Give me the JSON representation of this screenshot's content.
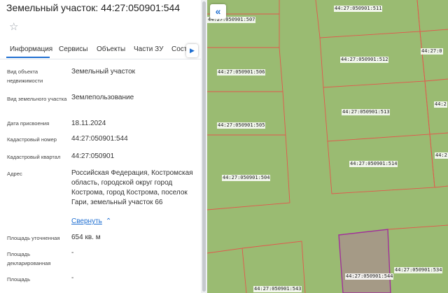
{
  "panel": {
    "title": "Земельный участок: 44:27:050901:544",
    "tabs": [
      "Информация",
      "Сервисы",
      "Объекты",
      "Части ЗУ",
      "Состав"
    ],
    "collapse_link": "Свернуть",
    "fields": [
      {
        "label": "Вид объекта недвижимости",
        "value": "Земельный участок"
      },
      {
        "label": "Вид земельного участка",
        "value": "Землепользование"
      },
      {
        "label": "Дата присвоения",
        "value": "18.11.2024"
      },
      {
        "label": "Кадастровый номер",
        "value": "44:27:050901:544"
      },
      {
        "label": "Кадастровый квартал",
        "value": "44:27:050901"
      },
      {
        "label": "Адрес",
        "value": "Российская Федерация, Костромская область, городской округ город Кострома, город Кострома, поселок Гари, земельный участок 66"
      },
      {
        "label": "Площадь уточненная",
        "value": "654 кв. м"
      },
      {
        "label": "Площадь декларированная",
        "value": "-"
      },
      {
        "label": "Площадь",
        "value": "-"
      }
    ]
  },
  "map": {
    "colors": {
      "land": "#9abb72",
      "boundary": "#e2574c",
      "selected_fill": "#a59a86",
      "selected_border": "#a1309a"
    },
    "plots": [
      {
        "label": "44:27:050901:507"
      },
      {
        "label": "44:27:050901:511"
      },
      {
        "label": "44:27:050901:506"
      },
      {
        "label": "44:27:050901:512"
      },
      {
        "label": "44:27:050901:505"
      },
      {
        "label": "44:27:050901:513"
      },
      {
        "label": "44:27:050901:504"
      },
      {
        "label": "44:27:050901:514"
      },
      {
        "label": "44:27:050901:544"
      },
      {
        "label": "44:27:050901:534"
      },
      {
        "label": "44:27:050901:543"
      }
    ]
  }
}
